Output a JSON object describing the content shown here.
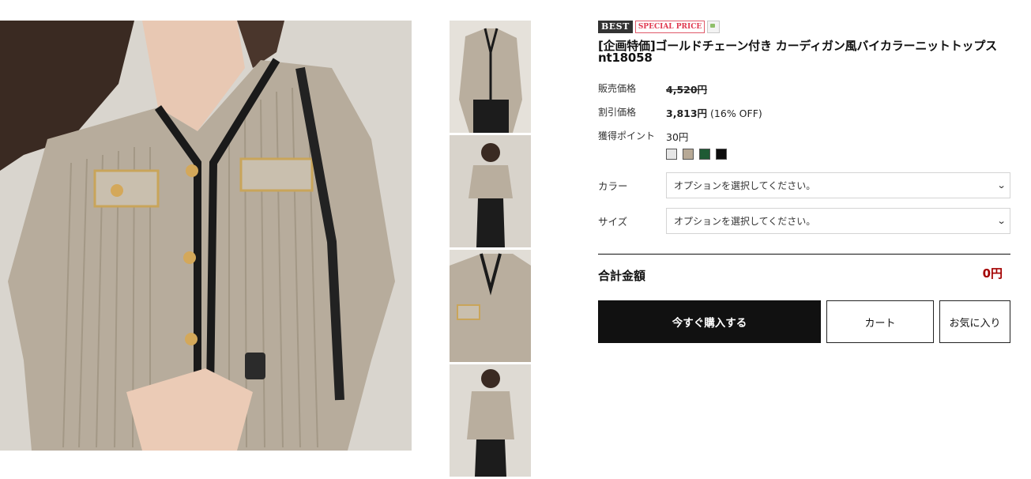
{
  "images": {
    "main_alt": "product-main-photo",
    "thumbnails": [
      "thumbnail-1",
      "thumbnail-2",
      "thumbnail-3",
      "thumbnail-4"
    ]
  },
  "badges": {
    "best": "BEST",
    "special": "SPECIAL PRICE"
  },
  "product": {
    "title": "[企画特価]ゴールドチェーン付き カーディガン風バイカラーニットトップス nt18058"
  },
  "prices": {
    "sale_label": "販売価格",
    "sale_value": "4,520円",
    "discount_label": "割引価格",
    "discount_value": "3,813円",
    "discount_pct": "(16% OFF)",
    "points_label": "獲得ポイント",
    "points_value": "30円"
  },
  "swatches": [
    {
      "name": "light-gray",
      "color": "#e6e6e6"
    },
    {
      "name": "beige",
      "color": "#b7a996"
    },
    {
      "name": "green",
      "color": "#1e5a34"
    },
    {
      "name": "black",
      "color": "#0c0c0c"
    }
  ],
  "options": {
    "color_label": "カラー",
    "color_value": "オプションを選択してください。",
    "size_label": "サイズ",
    "size_value": "オプションを選択してください。"
  },
  "total": {
    "label": "合計金額",
    "amount": "0円"
  },
  "actions": {
    "buy": "今すぐ購入する",
    "cart": "カート",
    "wishlist": "お気に入り"
  }
}
